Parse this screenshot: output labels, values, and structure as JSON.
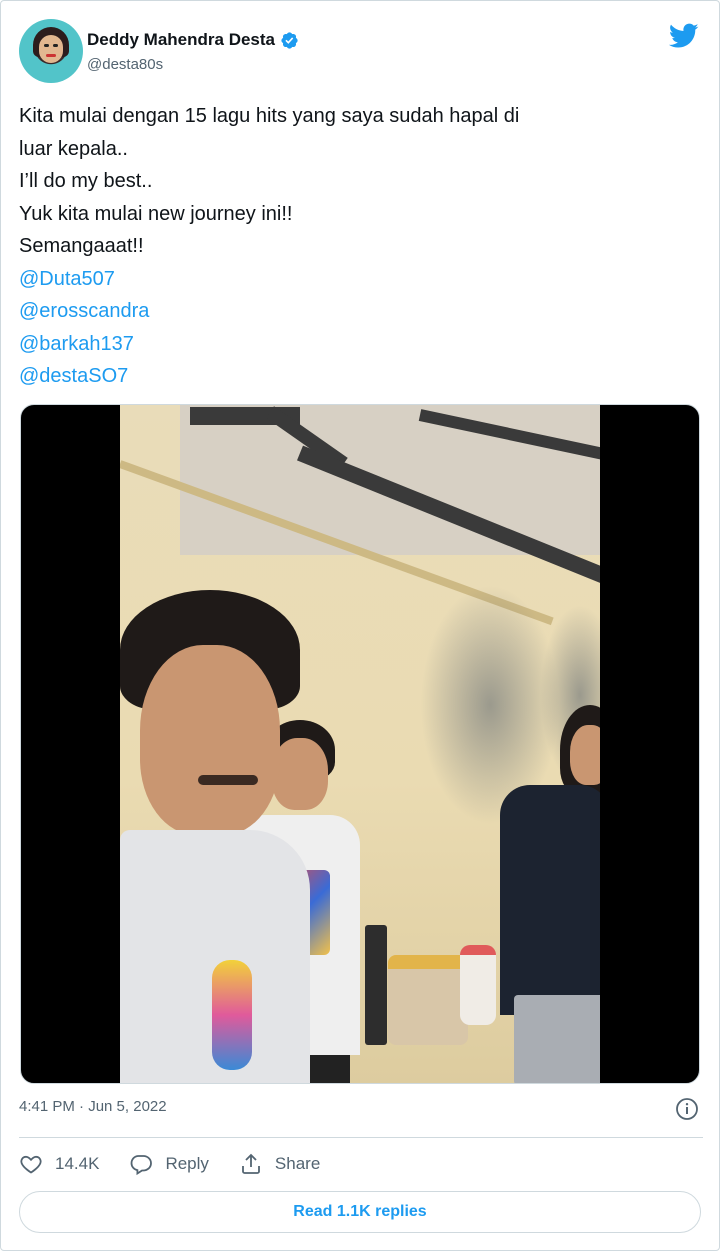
{
  "author": {
    "display_name": "Deddy Mahendra Desta",
    "handle": "@desta80s",
    "verified": true
  },
  "tweet": {
    "lines": [
      "Kita mulai dengan 15 lagu hits yang saya sudah hapal di",
      "luar kepala..",
      "I’ll do my best..",
      "Yuk kita mulai new journey ini!!",
      "Semangaaat!!"
    ],
    "mentions": [
      "@Duta507",
      "@erosscandra",
      "@barkah137",
      "@destaSO7"
    ]
  },
  "timestamp": "4:41 PM · Jun 5, 2022",
  "actions": {
    "like_count": "14.4K",
    "reply_label": "Reply",
    "share_label": "Share"
  },
  "read_replies_label": "Read 1.1K replies",
  "colors": {
    "accent": "#1d9bf0",
    "secondary_text": "#536471",
    "border": "#cfd9de"
  },
  "icons": [
    "verified-badge-icon",
    "twitter-bird-icon",
    "info-icon",
    "heart-icon",
    "reply-bubble-icon",
    "share-icon"
  ]
}
